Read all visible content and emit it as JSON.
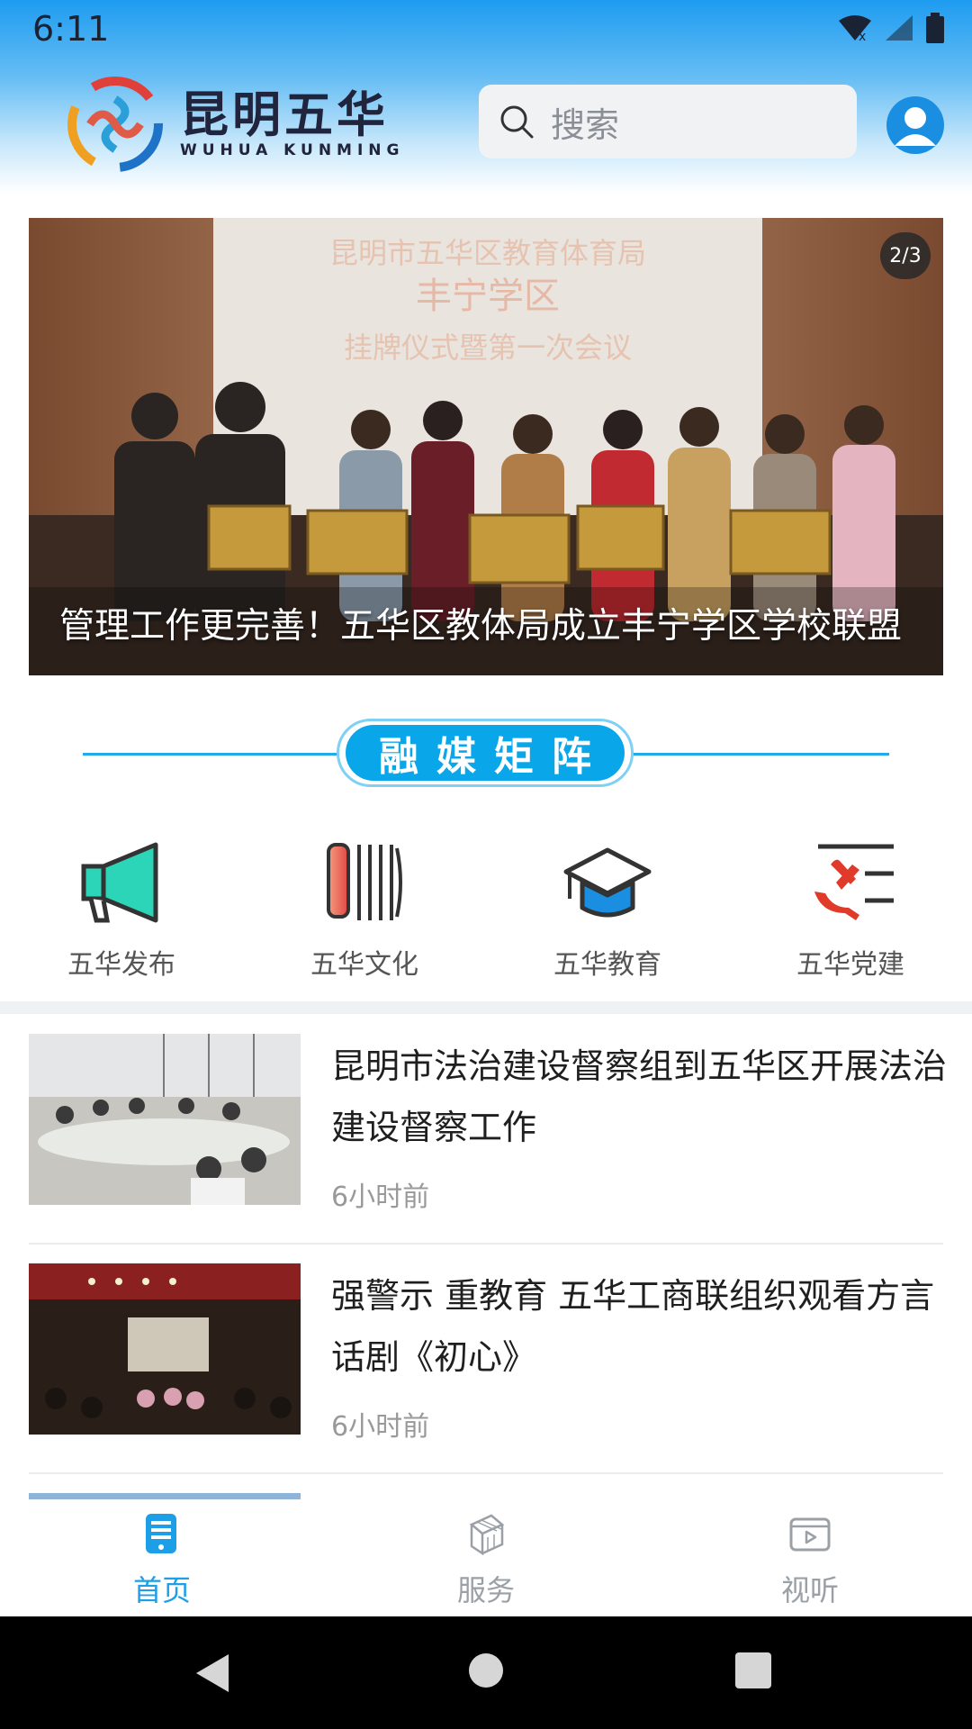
{
  "status_bar": {
    "time": "6:11"
  },
  "header": {
    "logo_cn": "昆明五华",
    "logo_en": "WUHUA KUNMING",
    "search_placeholder": "搜索"
  },
  "banner": {
    "counter": "2/3",
    "caption": "管理工作更完善！五华区教体局成立丰宁学区学校联盟",
    "photo_text": {
      "line1": "昆明市五华区教育体育局",
      "line2": "丰宁学区",
      "line3": "挂牌仪式暨第一次会议"
    }
  },
  "section": {
    "title": "融媒矩阵"
  },
  "matrix": [
    {
      "label": "五华发布",
      "icon": "megaphone-icon"
    },
    {
      "label": "五华文化",
      "icon": "culture-columns-icon"
    },
    {
      "label": "五华教育",
      "icon": "graduation-cap-icon"
    },
    {
      "label": "五华党建",
      "icon": "party-emblem-icon"
    }
  ],
  "news": [
    {
      "title": "昆明市法治建设督察组到五华区开展法治建设督察工作",
      "time": "6小时前"
    },
    {
      "title": "强警示 重教育 五华工商联组织观看方言话剧《初心》",
      "time": "6小时前"
    }
  ],
  "tabs": [
    {
      "label": "首页",
      "icon": "home-document-icon",
      "active": true
    },
    {
      "label": "服务",
      "icon": "service-cube-icon",
      "active": false
    },
    {
      "label": "视听",
      "icon": "video-player-icon",
      "active": false
    }
  ],
  "colors": {
    "accent": "#0aa6ea",
    "active_tab": "#1d9fe8",
    "inactive_tab": "#9aa0a6"
  }
}
